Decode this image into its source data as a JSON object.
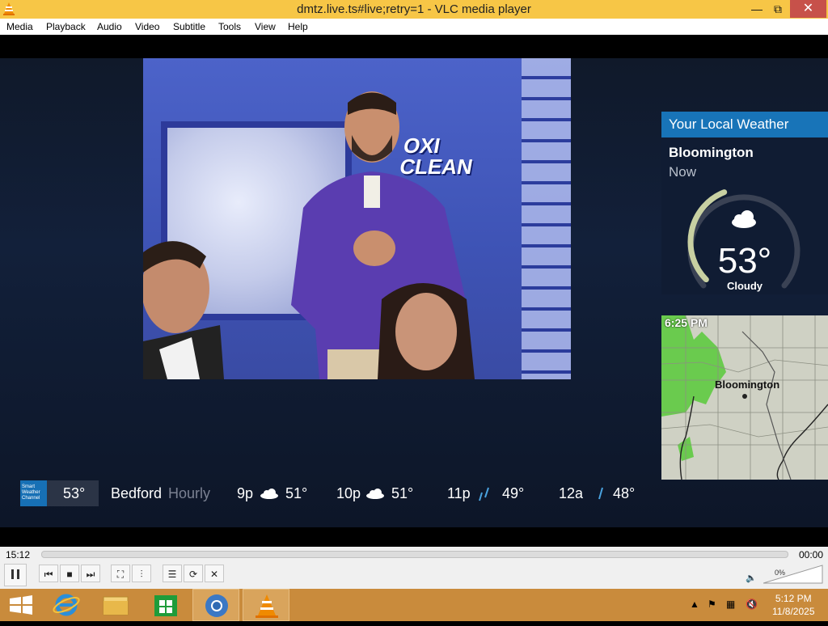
{
  "window": {
    "title": "dmtz.live.ts#live;retry=1 - VLC media player",
    "controls": [
      "—",
      "⧉",
      "✕"
    ]
  },
  "menu": [
    "Media",
    "Playback",
    "Audio",
    "Video",
    "Subtitle",
    "Tools",
    "View",
    "Help"
  ],
  "video": {
    "inset_logo_line1": "OXI",
    "inset_logo_line2": "CLEAN"
  },
  "weather_panel": {
    "header": "Your Local Weather",
    "city": "Bloomington",
    "period": "Now",
    "temperature": "53°",
    "condition": "Cloudy",
    "gauge_level": 0.42
  },
  "radar_map": {
    "time": "6:25 PM",
    "city": "Bloomington"
  },
  "ticker": {
    "logo_text": "Smart Weather Channel",
    "current_temp": "53°",
    "location": "Bedford",
    "section": "Hourly",
    "hours": [
      {
        "time": "9p",
        "icon": "cloud-icon",
        "temp": "51°"
      },
      {
        "time": "10p",
        "icon": "cloud-icon",
        "temp": "51°"
      },
      {
        "time": "11p",
        "icon": "rain-icon",
        "temp": "49°"
      },
      {
        "time": "12a",
        "icon": "rain-icon",
        "temp": "48°"
      }
    ]
  },
  "player": {
    "elapsed": "15:12",
    "remaining": "00:00",
    "volume": "0%",
    "progress": 0
  },
  "clock": {
    "time": "5:12 PM",
    "date": "11/8/2025"
  }
}
